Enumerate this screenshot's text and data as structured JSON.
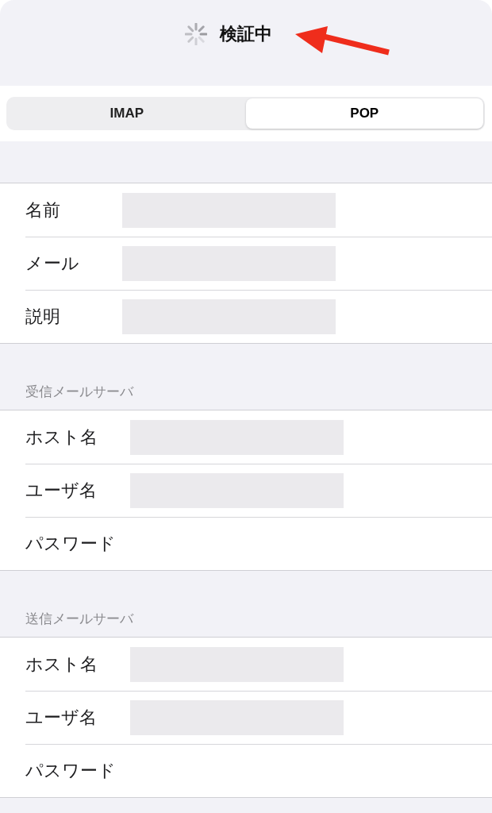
{
  "header": {
    "title": "検証中",
    "loading": true
  },
  "segments": [
    {
      "label": "IMAP",
      "selected": false
    },
    {
      "label": "POP",
      "selected": true
    }
  ],
  "sections": [
    {
      "rows": [
        {
          "label": "名前",
          "redacted": true
        },
        {
          "label": "メール",
          "redacted": true
        },
        {
          "label": "説明",
          "redacted": true
        }
      ]
    },
    {
      "header": "受信メールサーバ",
      "rows": [
        {
          "label": "ホスト名",
          "redacted": true
        },
        {
          "label": "ユーザ名",
          "redacted": true
        },
        {
          "label": "パスワード",
          "redacted": false
        }
      ]
    },
    {
      "header": "送信メールサーバ",
      "rows": [
        {
          "label": "ホスト名",
          "redacted": true
        },
        {
          "label": "ユーザ名",
          "redacted": true
        },
        {
          "label": "パスワード",
          "redacted": false
        }
      ]
    }
  ]
}
